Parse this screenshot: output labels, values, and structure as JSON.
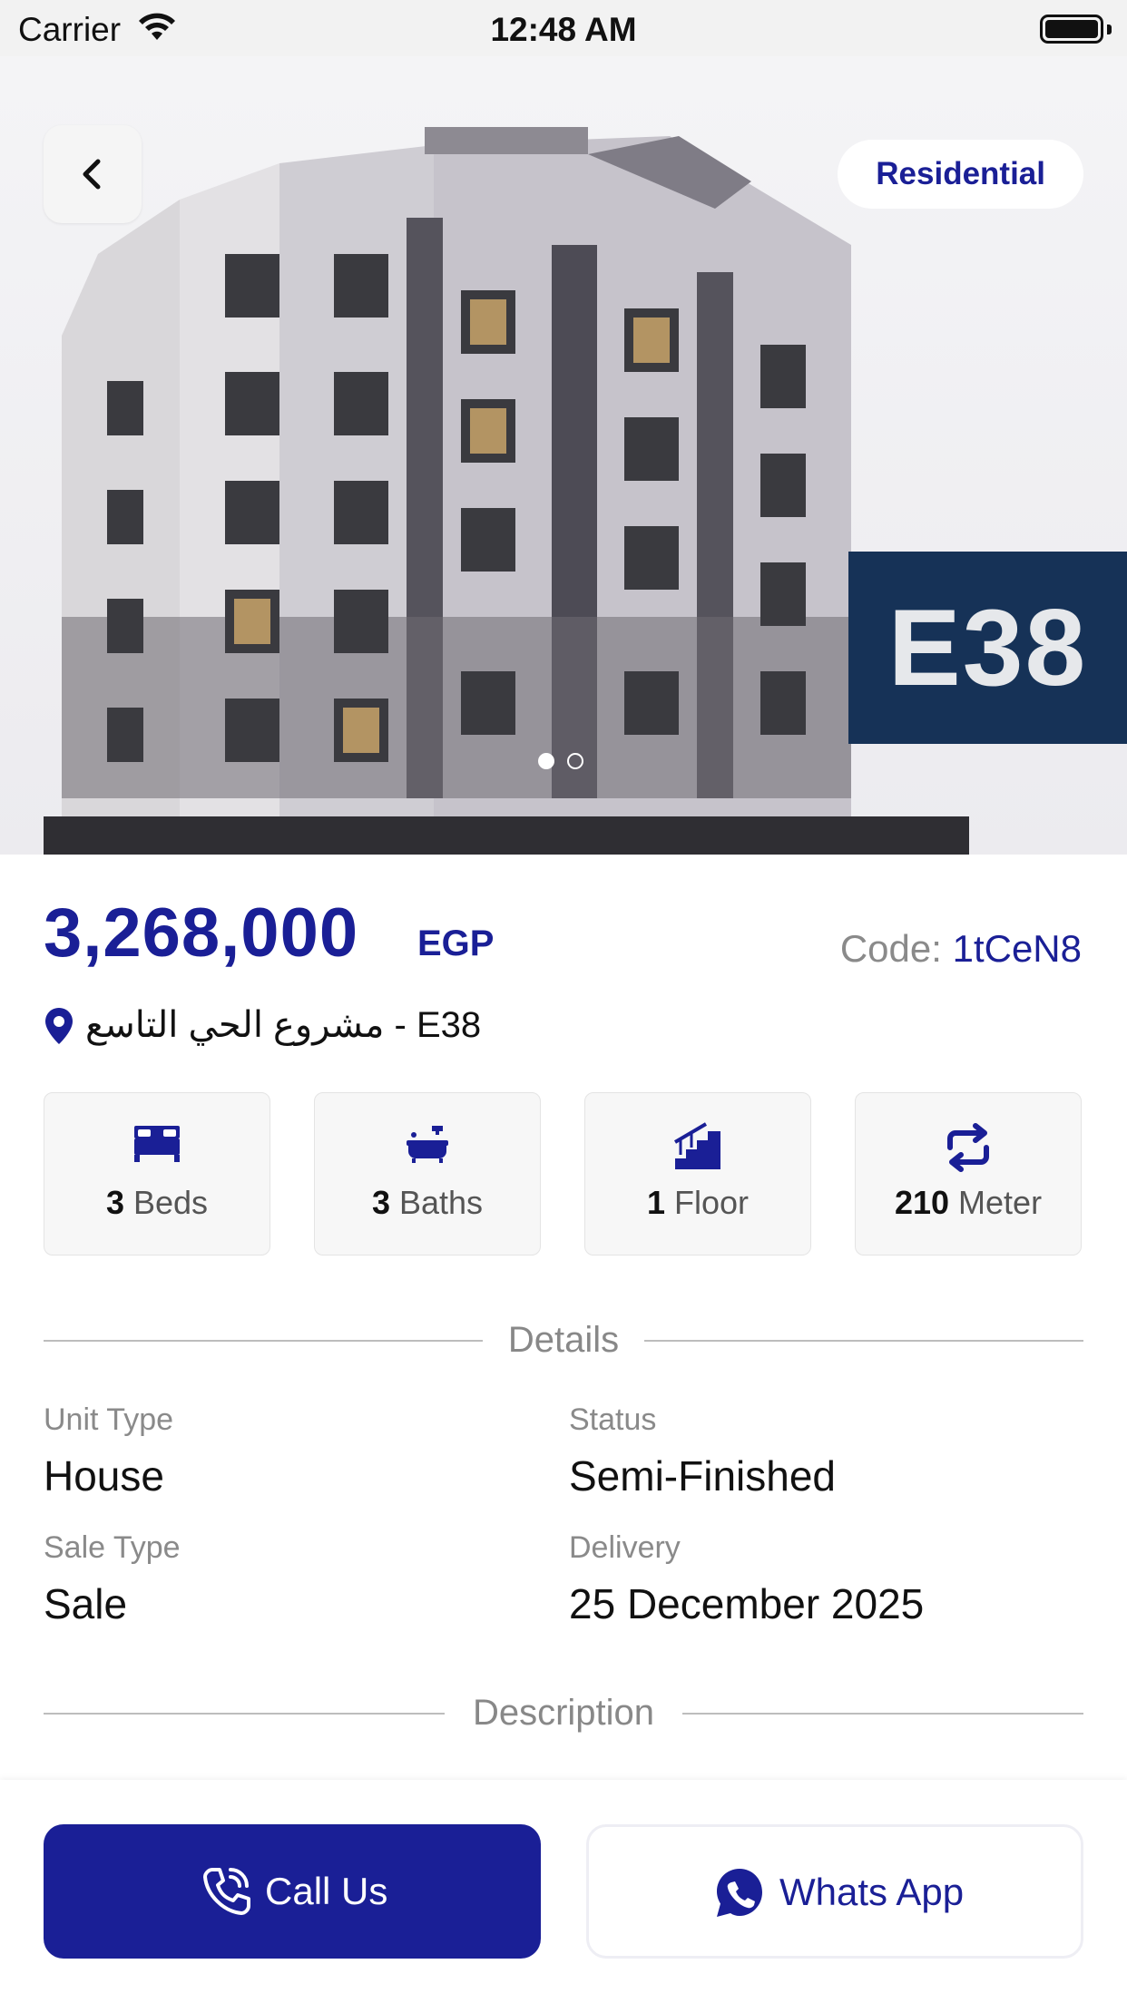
{
  "status_bar": {
    "carrier": "Carrier",
    "time": "12:48 AM"
  },
  "hero": {
    "category_badge": "Residential",
    "image_label": "E38",
    "image_count": 2,
    "active_image_index": 0
  },
  "listing": {
    "price": "3,268,000",
    "currency": "EGP",
    "code_label": "Code:",
    "code_value": "1tCeN8",
    "location": "مشروع الحي التاسع -  E38"
  },
  "features": [
    {
      "value": "3",
      "unit": "Beds",
      "icon": "bed-icon"
    },
    {
      "value": "3",
      "unit": "Baths",
      "icon": "bathtub-icon"
    },
    {
      "value": "1",
      "unit": "Floor",
      "icon": "stairs-icon"
    },
    {
      "value": "210",
      "unit": "Meter",
      "icon": "area-repeat-icon"
    }
  ],
  "details": {
    "section_title": "Details",
    "unit_type_label": "Unit Type",
    "unit_type_value": "House",
    "status_label": "Status",
    "status_value": "Semi-Finished",
    "sale_type_label": "Sale Type",
    "sale_type_value": "Sale",
    "delivery_label": "Delivery",
    "delivery_value": "25 December 2025"
  },
  "description": {
    "section_title": "Description"
  },
  "actions": {
    "call_label": "Call Us",
    "whatsapp_label": "Whats App"
  },
  "colors": {
    "primary": "#1a1f96",
    "banner": "#163257"
  }
}
